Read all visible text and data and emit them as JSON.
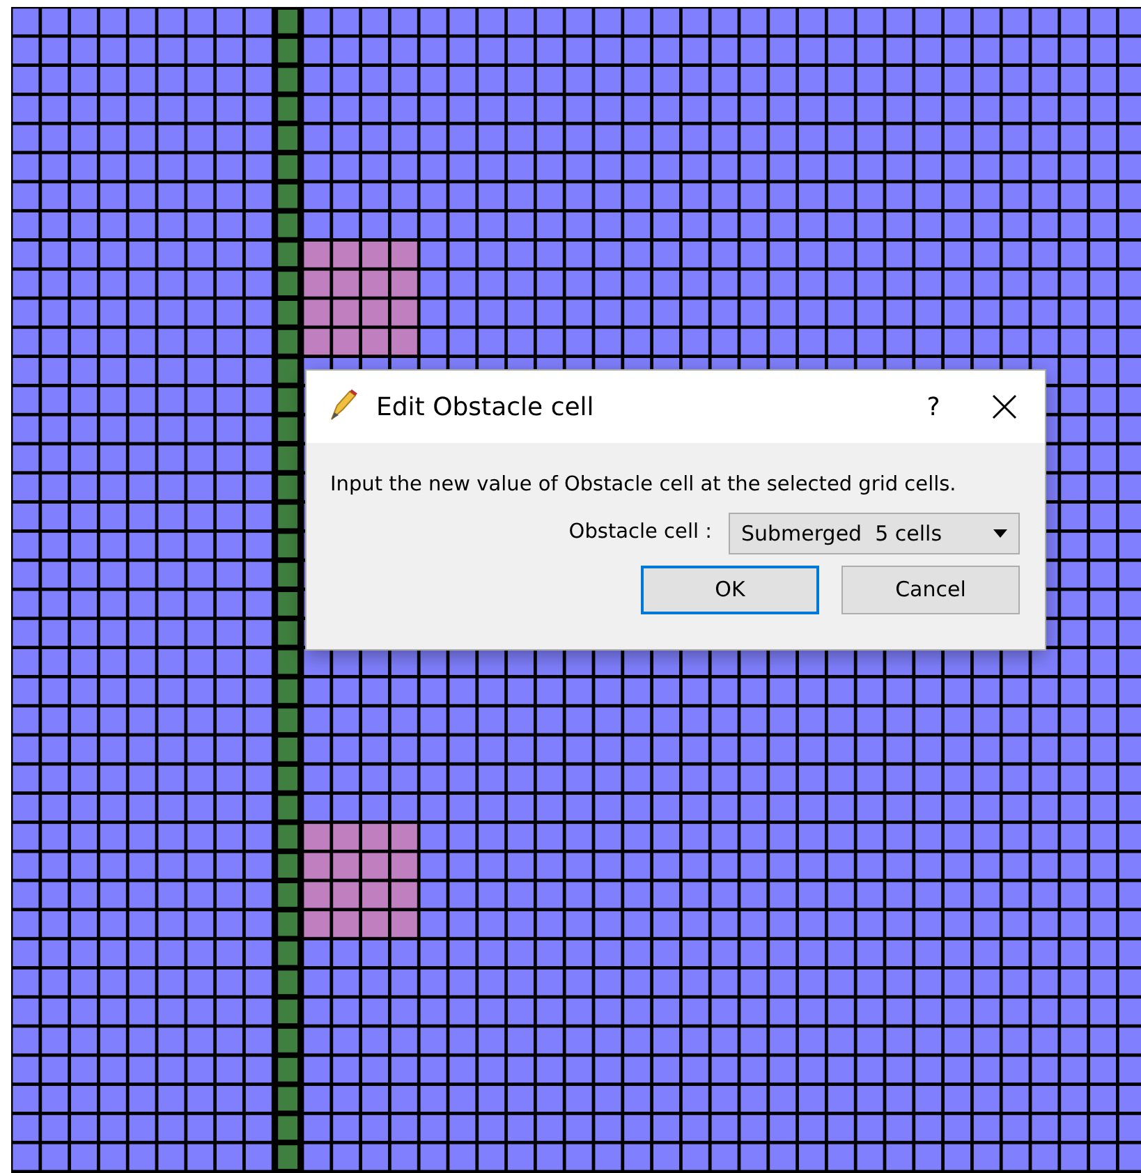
{
  "dialog": {
    "title": "Edit Obstacle cell",
    "help": "?",
    "message": "Input the new value of Obstacle cell at the selected grid cells.",
    "field": {
      "label": "Obstacle cell :",
      "value": "Submerged  5 cells"
    },
    "buttons": [
      {
        "label": "OK",
        "default": true
      },
      {
        "label": "Cancel",
        "default": false
      }
    ]
  }
}
